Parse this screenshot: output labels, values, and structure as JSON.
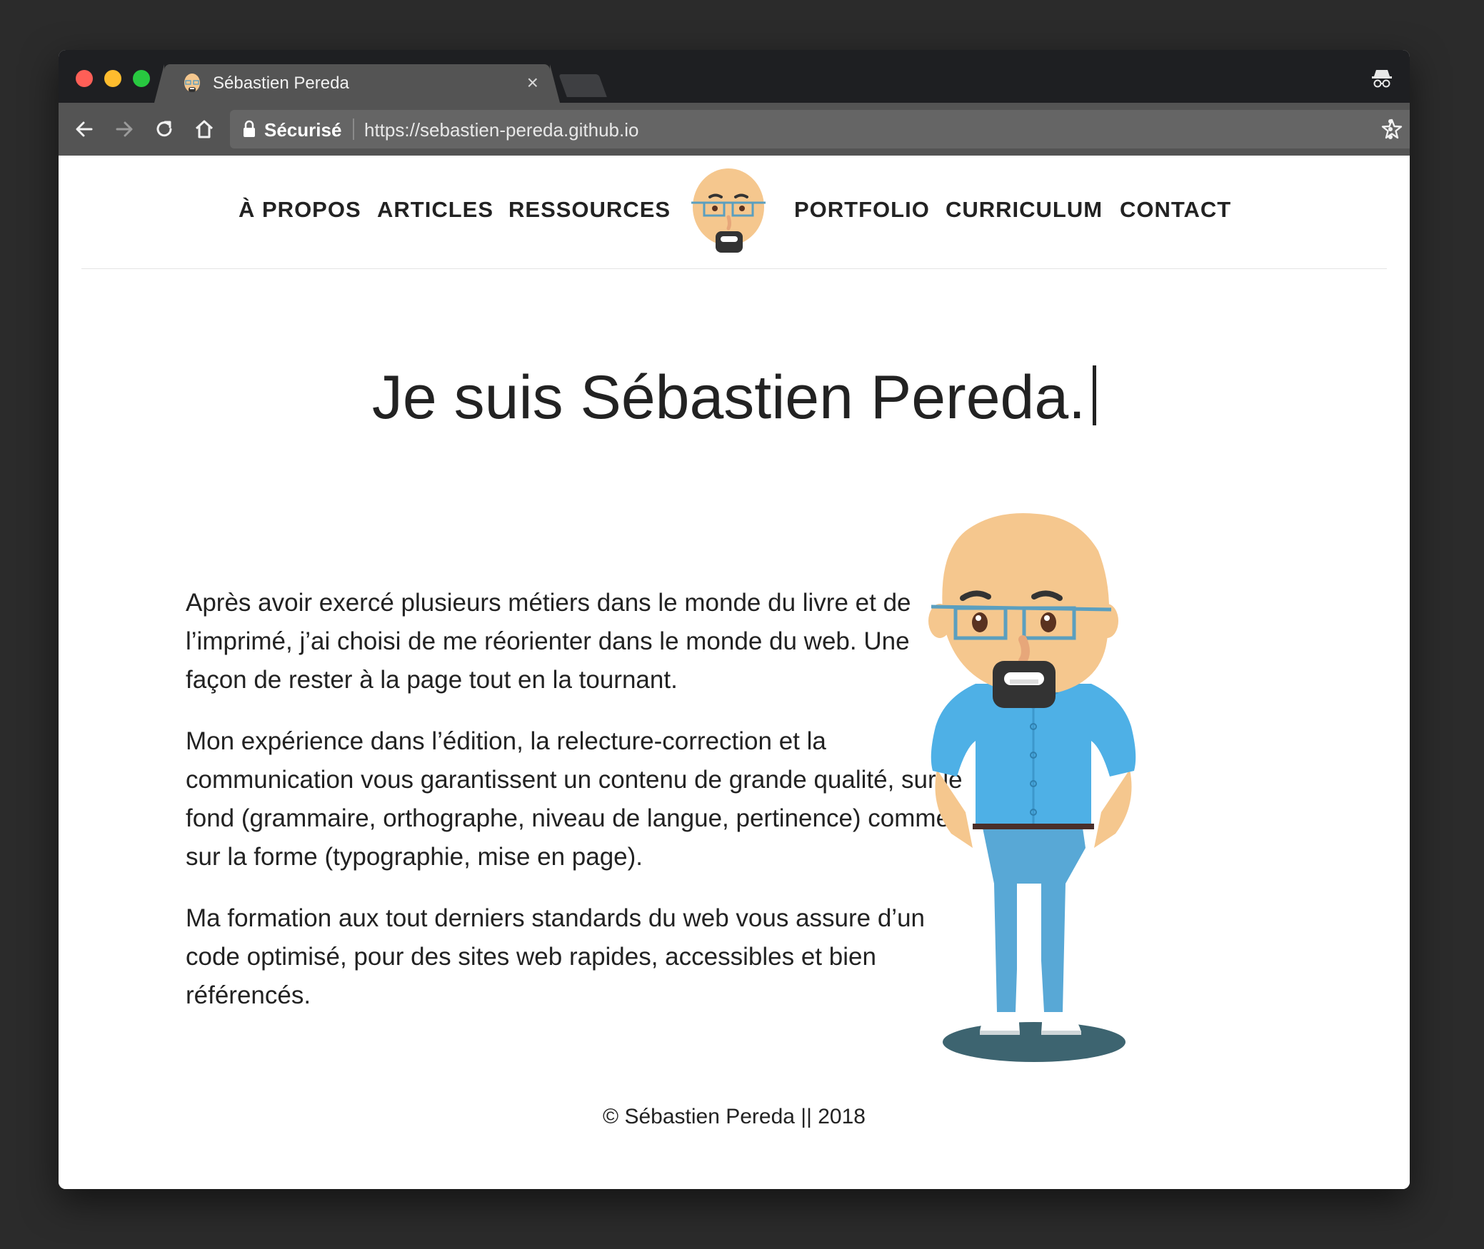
{
  "browser": {
    "tab_title": "Sébastien Pereda",
    "tab_close": "×",
    "secure_label": "Sécurisé",
    "url": "https://sebastien-pereda.github.io"
  },
  "nav": {
    "about": "À PROPOS",
    "articles": "ARTICLES",
    "resources": "RESSOURCES",
    "portfolio": "PORTFOLIO",
    "curriculum": "CURRICULUM",
    "contact": "CONTACT"
  },
  "hero": {
    "title": "Je suis Sébastien Pereda."
  },
  "bio": {
    "p1": "Après avoir exercé plusieurs métiers dans le monde du livre et de l’imprimé, j’ai choisi de me réorienter dans le monde du web. Une façon de rester à la page tout en la tournant.",
    "p2": "Mon expérience dans l’édition, la relecture-correction et la communication vous garantissent un contenu de grande qualité, sur le fond (grammaire, orthographe, niveau de langue, pertinence) comme sur la forme (typographie, mise en page).",
    "p3": "Ma formation aux tout derniers standards du web vous assure d’un code optimisé, pour des sites web rapides, accessibles et bien référencés."
  },
  "footer": {
    "text": "© Sébastien Pereda || 2018"
  },
  "colors": {
    "skin": "#f5c78e",
    "shirt": "#4eb0e6",
    "jeans": "#58a8d6",
    "beard": "#333333",
    "glasses": "#5b9fbf",
    "shadow": "#3d6470",
    "chrome_dark": "#1e1f22",
    "chrome_toolbar": "#545454"
  },
  "icons": {
    "back": "arrow-left-icon",
    "forward": "arrow-right-icon",
    "reload": "reload-icon",
    "home": "home-icon",
    "lock": "lock-icon",
    "star": "star-icon",
    "menu": "kebab-menu-icon",
    "incognito": "incognito-icon"
  }
}
